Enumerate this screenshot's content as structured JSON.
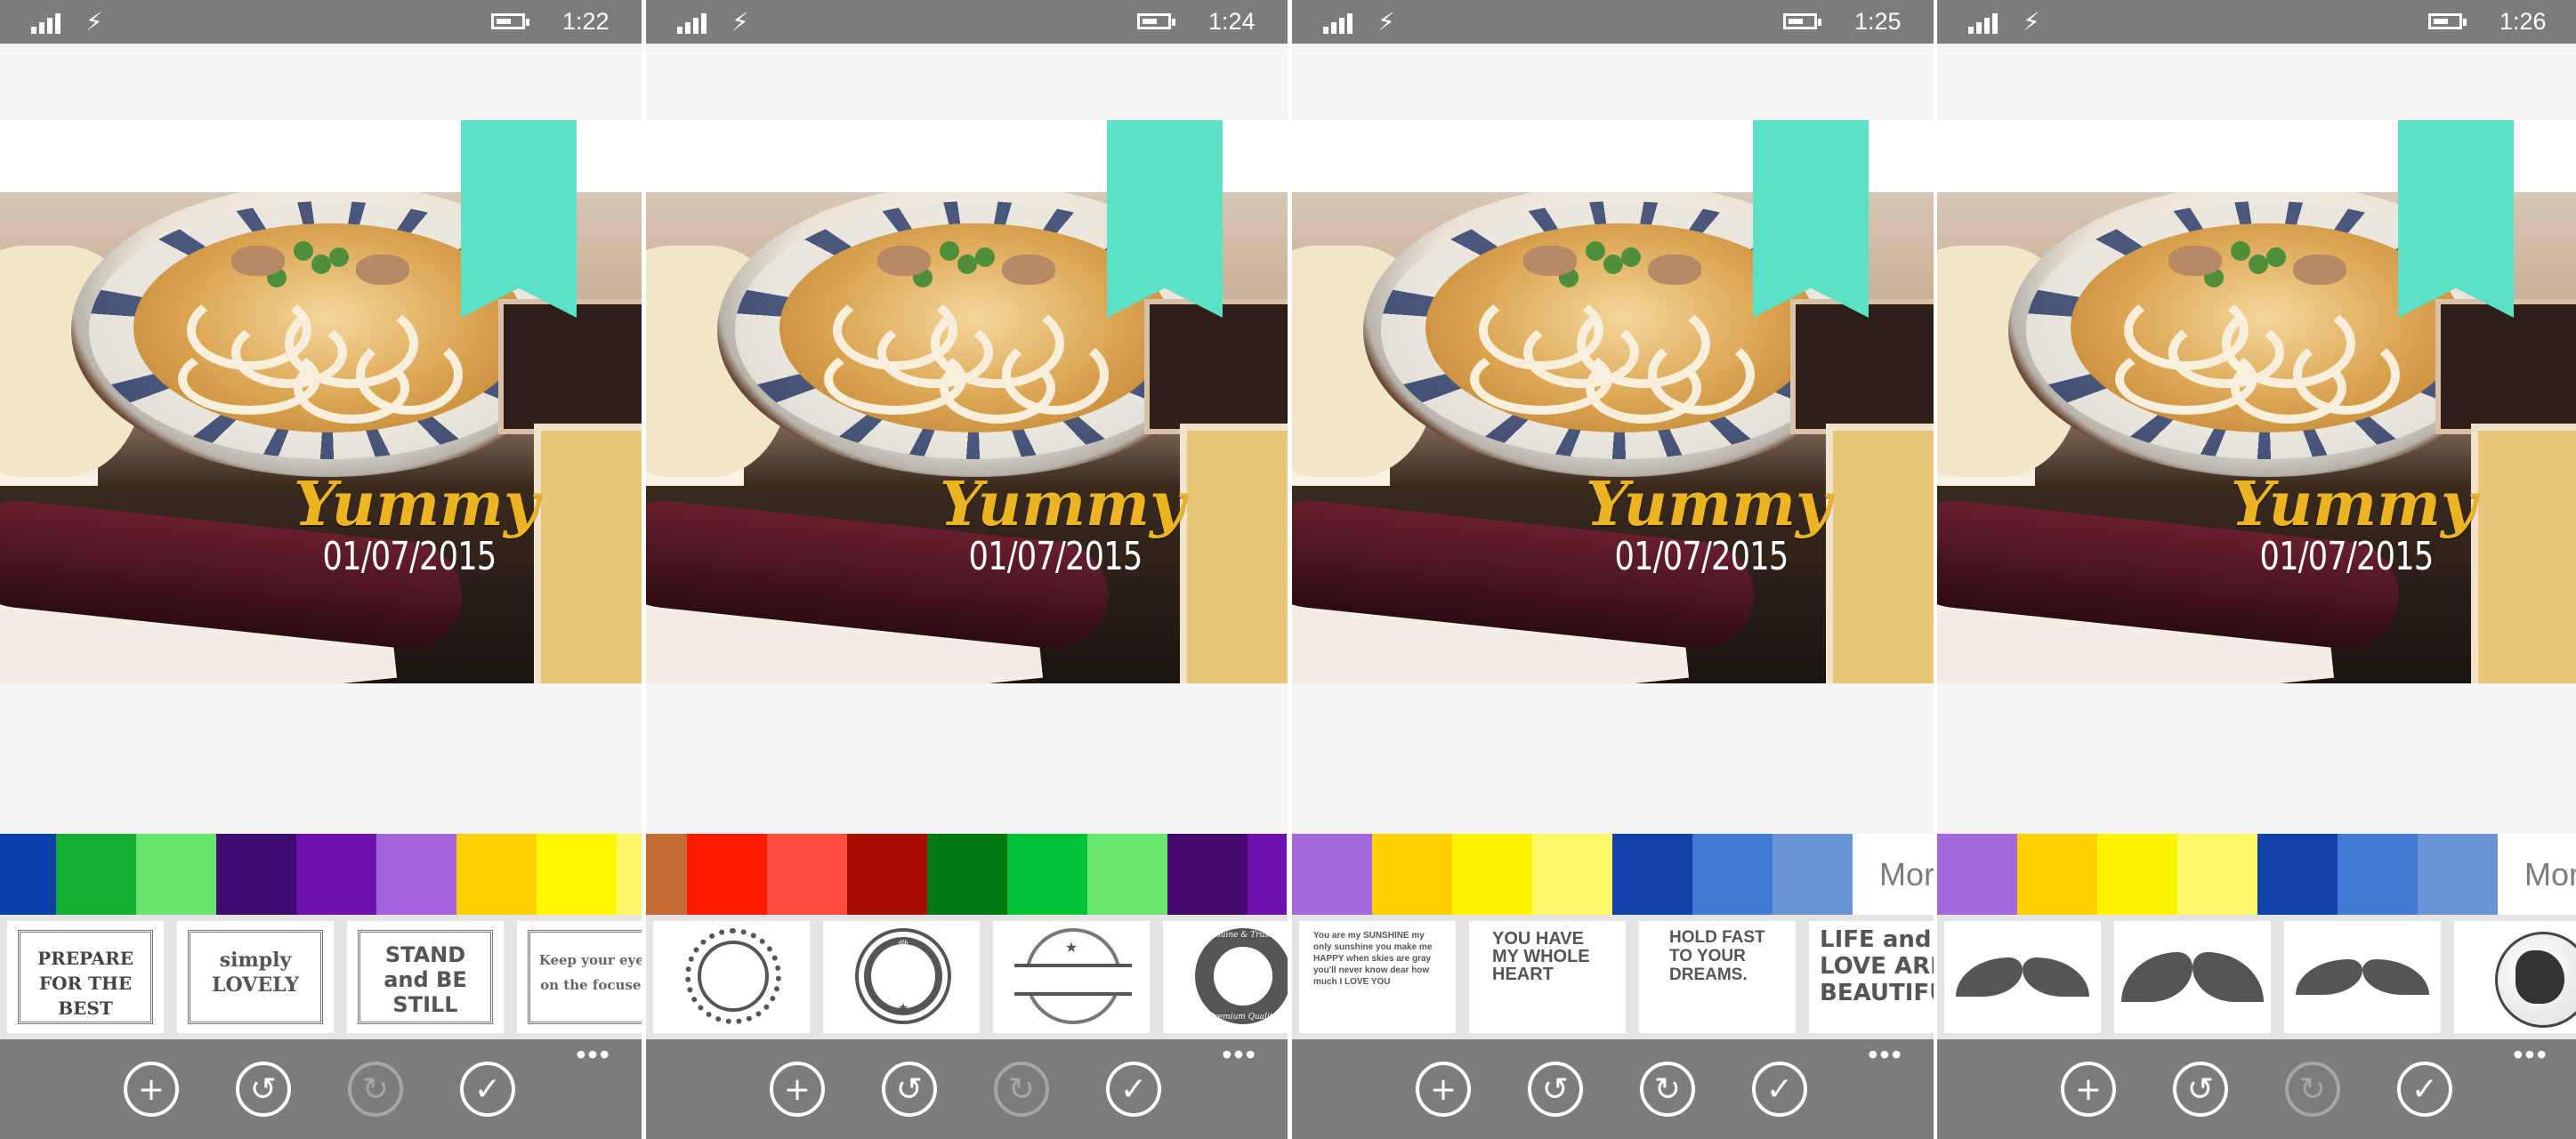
{
  "panels": [
    {
      "time": "1:22",
      "swatches": [
        "#0b3ea8",
        "#14b035",
        "#66e36a",
        "#3f0a70",
        "#6c11ad",
        "#a564dc",
        "#ffd100",
        "#fff700",
        "#fcf86a",
        "#1645a6"
      ],
      "more": "",
      "set": "typography"
    },
    {
      "time": "1:24",
      "swatches": [
        "#c46a33",
        "#ff1a00",
        "#ff4e3e",
        "#a60f00",
        "#007a10",
        "#00c234",
        "#69e66d",
        "#46096f",
        "#6d11ad"
      ],
      "more": "",
      "set": "badges"
    },
    {
      "time": "1:25",
      "swatches": [
        "#a568dc",
        "#ffd100",
        "#fff400",
        "#fdfa6a",
        "#1042a8",
        "#4479d6",
        "#6a94d8"
      ],
      "more": "Mor",
      "set": "quotes"
    },
    {
      "time": "1:26",
      "swatches": [
        "#a568dc",
        "#ffd100",
        "#fff400",
        "#fdfa6a",
        "#1042a8",
        "#4479d6",
        "#6a94d8"
      ],
      "more": "Mor",
      "set": "mustaches"
    }
  ],
  "photo_text": {
    "title": "Yummy",
    "date": "01/07/2015"
  },
  "stickers": {
    "typography": [
      "PREPARE FOR THE BEST",
      "simply LOVELY",
      "STAND and BE STILL",
      "Keep your eyes on the focused"
    ],
    "quotes": [
      "You are my SUNSHINE my only sunshine you make me HAPPY when skies are gray you'll never know dear how much I LOVE YOU",
      "YOU HAVE MY WHOLE HEART",
      "HOLD FAST TO YOUR DREAMS.",
      "LIFE and LOVE ARE BEAUTIFUL"
    ],
    "badge_text": [
      "Genuine & Trusted",
      "Premium Quality"
    ]
  },
  "appbar": {
    "add_icon": "plus-icon",
    "undo_icon": "undo-icon",
    "redo_icon": "redo-icon",
    "done_icon": "check-icon",
    "more": "•••"
  }
}
